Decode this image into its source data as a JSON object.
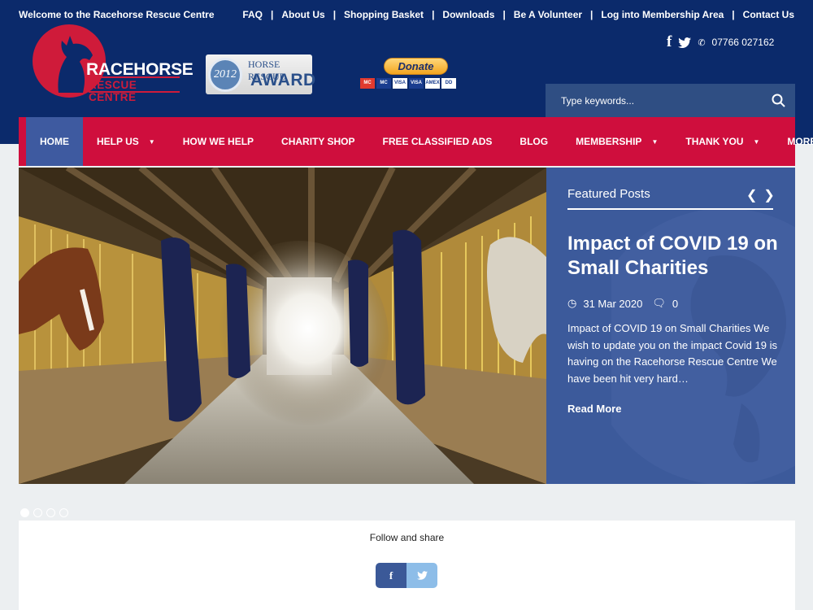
{
  "header": {
    "welcome": "Welcome to the Racehorse Rescue Centre",
    "top_links": [
      "FAQ",
      "About Us",
      "Shopping Basket",
      "Downloads",
      "Be A Volunteer",
      "Log into Membership Area",
      "Contact Us"
    ],
    "logo_line1": "RACEHORSE",
    "logo_line2": "RESCUE CENTRE",
    "award_year": "2012",
    "award_line1": "HORSE RESCUE",
    "award_line2": "AWARD",
    "donate_label": "Donate",
    "payment_cards": [
      "MC",
      "MC",
      "VISA",
      "VISA",
      "AMEX",
      "DD"
    ],
    "phone": "07766 027162",
    "search_placeholder": "Type keywords..."
  },
  "nav": {
    "items": [
      {
        "label": "HOME",
        "has_dropdown": false,
        "active": true
      },
      {
        "label": "HELP US",
        "has_dropdown": true
      },
      {
        "label": "HOW WE HELP",
        "has_dropdown": false
      },
      {
        "label": "CHARITY SHOP",
        "has_dropdown": false
      },
      {
        "label": "FREE CLASSIFIED ADS",
        "has_dropdown": false
      },
      {
        "label": "BLOG",
        "has_dropdown": false
      },
      {
        "label": "MEMBERSHIP",
        "has_dropdown": true
      },
      {
        "label": "THANK YOU",
        "has_dropdown": true
      },
      {
        "label": "MORE",
        "has_dropdown": true
      }
    ]
  },
  "featured": {
    "heading": "Featured Posts",
    "title": "Impact of COVID 19 on Small Charities",
    "date": "31 Mar 2020",
    "comments": "0",
    "excerpt": "Impact of COVID 19 on Small Charities We wish to update you on the impact Covid 19 is having on the Racehorse Rescue Centre We have been hit very hard…",
    "read_more": "Read More"
  },
  "slider": {
    "total_slides": 4,
    "active_slide": 1
  },
  "share": {
    "label": "Follow and share",
    "facebook": "f",
    "twitter": "twitter-bird-icon"
  },
  "colors": {
    "header_bg": "#0b2a6b",
    "nav_bg": "#cf0e3d",
    "nav_active": "#3e5aa0",
    "featured_bg": "#3c5a9b",
    "brand_red": "#cf1b3a"
  }
}
